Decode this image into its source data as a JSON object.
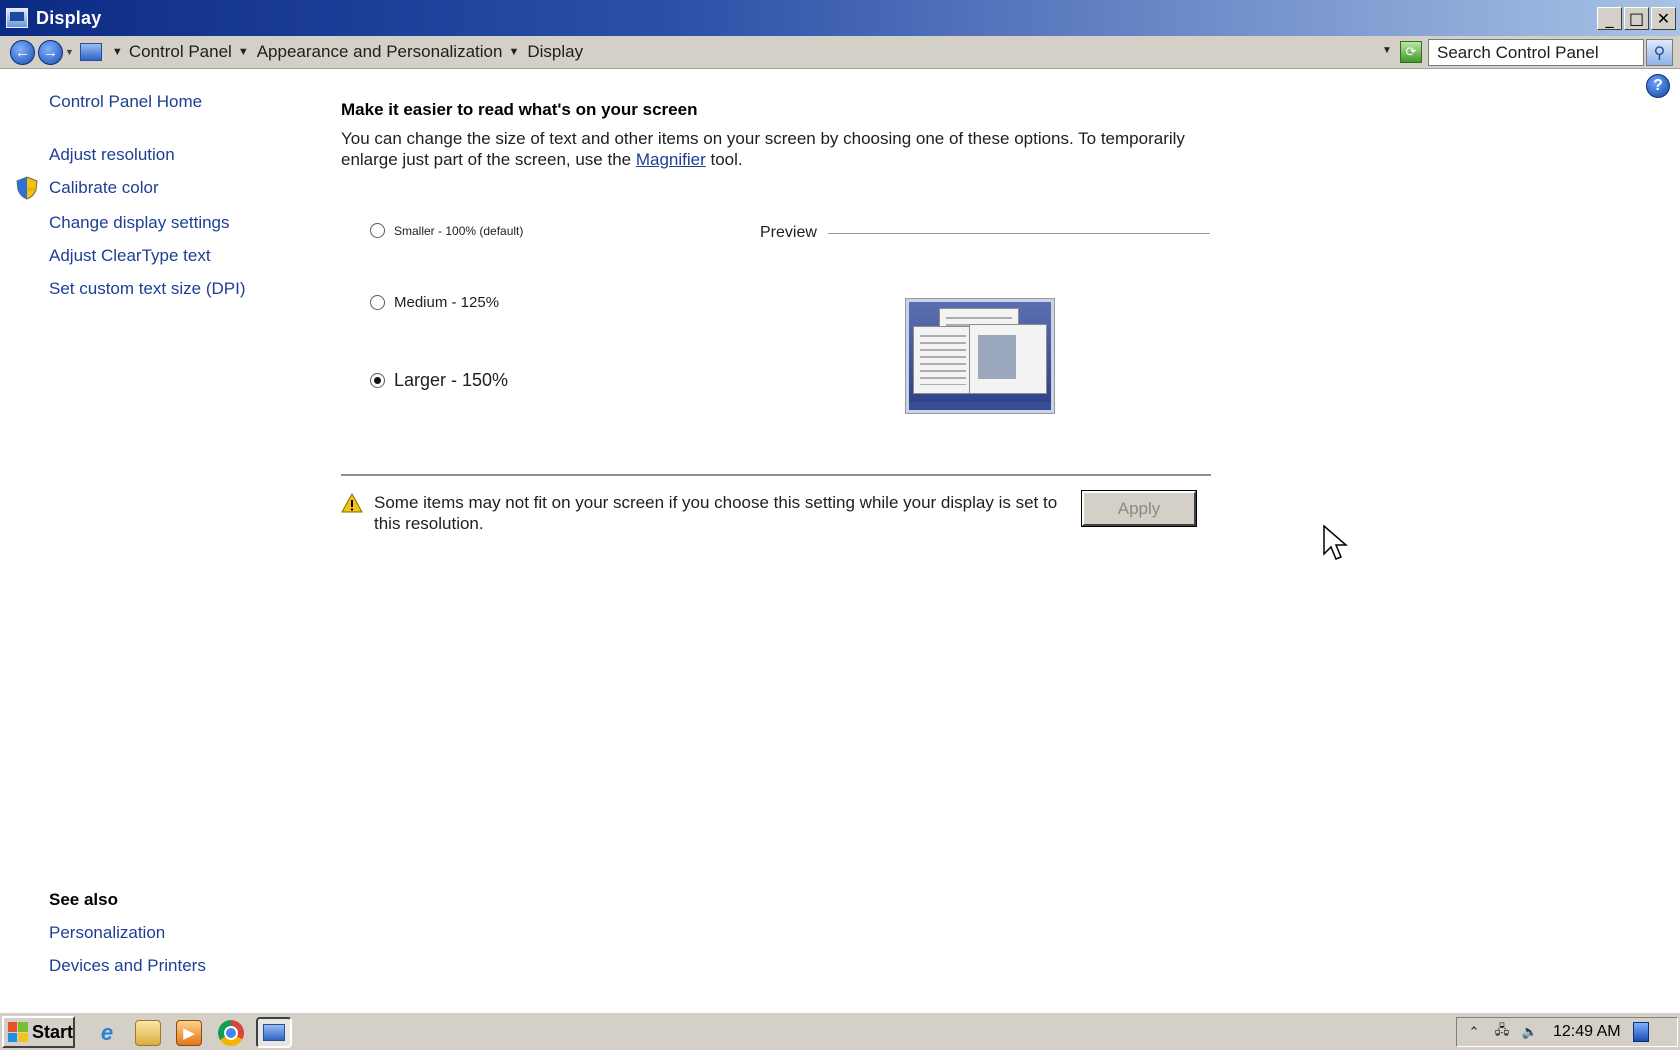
{
  "window": {
    "title": "Display",
    "controls": {
      "minimize": "_",
      "maximize": "□",
      "close": "✕"
    }
  },
  "addressbar": {
    "breadcrumb": [
      "Control Panel",
      "Appearance and Personalization",
      "Display"
    ],
    "search_placeholder": "Search Control Panel"
  },
  "sidebar": {
    "home": "Control Panel Home",
    "items": [
      {
        "label": "Adjust resolution",
        "icon": null
      },
      {
        "label": "Calibrate color",
        "icon": "shield-icon"
      },
      {
        "label": "Change display settings",
        "icon": null
      },
      {
        "label": "Adjust ClearType text",
        "icon": null
      },
      {
        "label": "Set custom text size (DPI)",
        "icon": null
      }
    ],
    "see_also": {
      "heading": "See also",
      "items": [
        "Personalization",
        "Devices and Printers"
      ]
    }
  },
  "main": {
    "heading": "Make it easier to read what's on your screen",
    "description_before": "You can change the size of text and other items on your screen by choosing one of these options. To temporarily enlarge just part of the screen, use the ",
    "magnifier_link": "Magnifier",
    "description_after": " tool.",
    "options": [
      {
        "label": "Smaller - 100% (default)",
        "checked": false
      },
      {
        "label": "Medium - 125%",
        "checked": false
      },
      {
        "label": "Larger - 150%",
        "checked": true
      }
    ],
    "preview_label": "Preview",
    "warning_text": "Some items may not fit on your screen if you choose this setting while your display is set to this resolution.",
    "apply_label": "Apply",
    "apply_enabled": false
  },
  "taskbar": {
    "start_label": "Start",
    "pinned": [
      "internet-explorer-icon",
      "windows-explorer-icon",
      "media-player-icon",
      "chrome-icon",
      "control-panel-icon"
    ],
    "clock": "12:49 AM"
  },
  "colors": {
    "link": "#1c3f94",
    "titlebar_start": "#0b2a84",
    "titlebar_end": "#a9c3e6",
    "chrome_gray": "#d4d0c8"
  }
}
